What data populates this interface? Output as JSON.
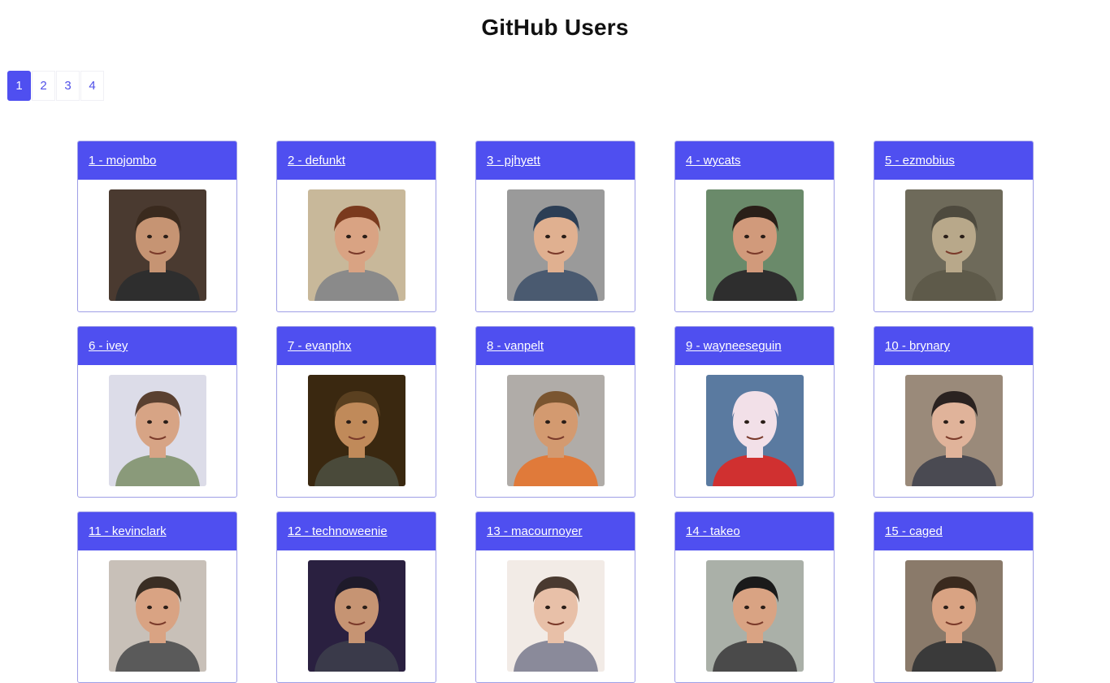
{
  "header": {
    "title": "GitHub Users"
  },
  "pagination": {
    "pages": [
      "1",
      "2",
      "3",
      "4"
    ],
    "active": "1"
  },
  "users": [
    {
      "label": "1 - mojombo",
      "bg": "#4a3a30",
      "skin": "#c69473",
      "hair": "#3a2a1e",
      "shirt": "#2e2e2e"
    },
    {
      "label": "2 - defunkt",
      "bg": "#c8b89a",
      "skin": "#d9a383",
      "hair": "#7a3a1e",
      "shirt": "#8a8a8a"
    },
    {
      "label": "3 - pjhyett",
      "bg": "#9a9a9a",
      "skin": "#e0b090",
      "hair": "#2c3e55",
      "shirt": "#4a5a70"
    },
    {
      "label": "4 - wycats",
      "bg": "#6a8a6a",
      "skin": "#d19a7b",
      "hair": "#2a1f18",
      "shirt": "#2e2e2e"
    },
    {
      "label": "5 - ezmobius",
      "bg": "#6e6a5a",
      "skin": "#b8a88a",
      "hair": "#4e4a3e",
      "shirt": "#5e5a4a"
    },
    {
      "label": "6 - ivey",
      "bg": "#dcdce8",
      "skin": "#d7a485",
      "hair": "#5a4030",
      "shirt": "#8a9a7a"
    },
    {
      "label": "7 - evanphx",
      "bg": "#3a2810",
      "skin": "#c08a5a",
      "hair": "#5a4020",
      "shirt": "#4a4a3a"
    },
    {
      "label": "8 - vanpelt",
      "bg": "#b0aca8",
      "skin": "#d39a70",
      "hair": "#7a5530",
      "shirt": "#e07a3a"
    },
    {
      "label": "9 - wayneeseguin",
      "bg": "#5a7aa0",
      "skin": "#f2e0e8",
      "hair": "#f2e0e8",
      "shirt": "#d03030"
    },
    {
      "label": "10 - brynary",
      "bg": "#9a8a7a",
      "skin": "#e0b39a",
      "hair": "#2a2220",
      "shirt": "#4a4a52"
    },
    {
      "label": "11 - kevinclark",
      "bg": "#c8c0b8",
      "skin": "#d9a383",
      "hair": "#3a2e24",
      "shirt": "#5a5a5a"
    },
    {
      "label": "12 - technoweenie",
      "bg": "#2a2040",
      "skin": "#c69473",
      "hair": "#1e1a2a",
      "shirt": "#3a3a4a"
    },
    {
      "label": "13 - macournoyer",
      "bg": "#f2ebe6",
      "skin": "#e8c0a8",
      "hair": "#4a3a30",
      "shirt": "#8a8a9a"
    },
    {
      "label": "14 - takeo",
      "bg": "#aab0a8",
      "skin": "#d9a383",
      "hair": "#1a1a1a",
      "shirt": "#4a4a4a"
    },
    {
      "label": "15 - caged",
      "bg": "#8a7a6a",
      "skin": "#d9a383",
      "hair": "#3a2a1e",
      "shirt": "#3a3a3a"
    }
  ]
}
